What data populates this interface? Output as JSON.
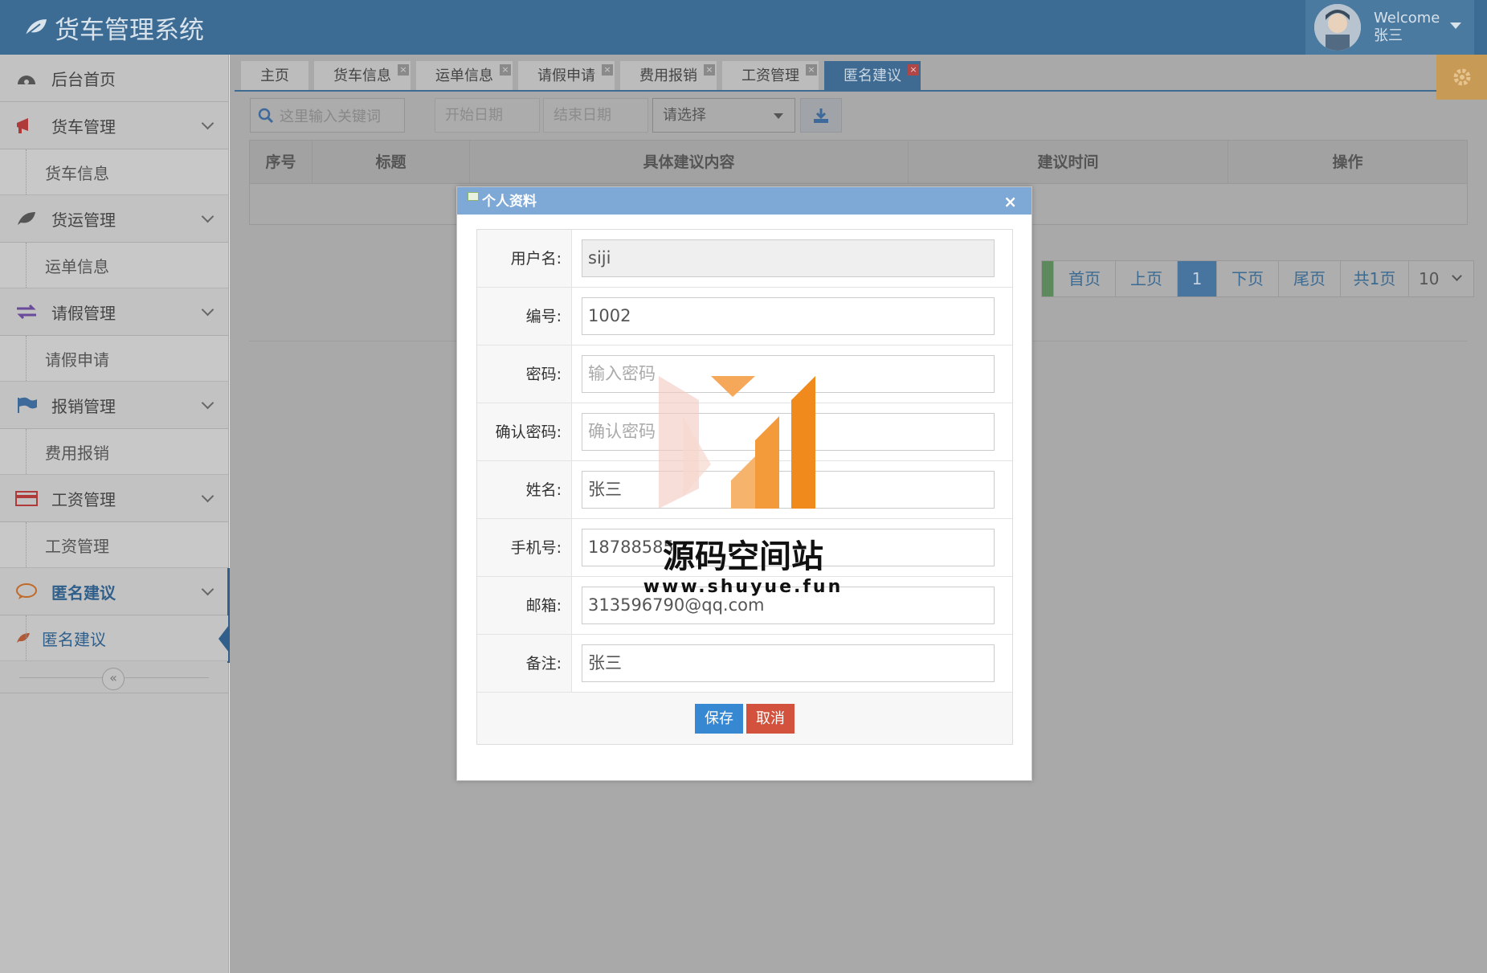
{
  "app": {
    "title": "货车管理系统"
  },
  "user": {
    "welcome": "Welcome",
    "name": "张三"
  },
  "sidebar": {
    "home": "后台首页",
    "groups": [
      {
        "label": "货车管理",
        "sub": "货车信息"
      },
      {
        "label": "货运管理",
        "sub": "运单信息"
      },
      {
        "label": "请假管理",
        "sub": "请假申请"
      },
      {
        "label": "报销管理",
        "sub": "费用报销"
      },
      {
        "label": "工资管理",
        "sub": "工资管理"
      },
      {
        "label": "匿名建议",
        "sub": "匿名建议"
      }
    ],
    "collapse_icon": "«"
  },
  "tabs": [
    "主页",
    "货车信息",
    "运单信息",
    "请假申请",
    "费用报销",
    "工资管理",
    "匿名建议"
  ],
  "tab_close": "×",
  "toolbar": {
    "search_placeholder": "这里输入关键词",
    "start_date": "开始日期",
    "end_date": "结束日期",
    "select": "请选择"
  },
  "table": {
    "headers": [
      "序号",
      "标题",
      "具体建议内容",
      "建议时间",
      "操作"
    ]
  },
  "pager": {
    "first": "首页",
    "prev": "上页",
    "current": "1",
    "next": "下页",
    "last": "尾页",
    "total": "共1页",
    "size": "10"
  },
  "modal": {
    "title": "个人资料",
    "close": "×",
    "fields": [
      {
        "label": "用户名:",
        "value": "siji"
      },
      {
        "label": "编号:",
        "value": "1002"
      },
      {
        "label": "密码:",
        "value": "输入密码"
      },
      {
        "label": "确认密码:",
        "value": "确认密码"
      },
      {
        "label": "姓名:",
        "value": "张三"
      },
      {
        "label": "手机号:",
        "value": "18788585"
      },
      {
        "label": "邮箱:",
        "value": "313596790@qq.com"
      },
      {
        "label": "备注:",
        "value": "张三"
      }
    ],
    "save": "保存",
    "cancel": "取消"
  },
  "watermark": {
    "name": "源码空间站",
    "url": "www.shuyue.fun"
  },
  "colors": {
    "header": "#3c6b94",
    "active": "#2f5f8a",
    "save": "#3588d1",
    "cancel": "#d3523d",
    "watermark_orange": "#f08a1c"
  }
}
